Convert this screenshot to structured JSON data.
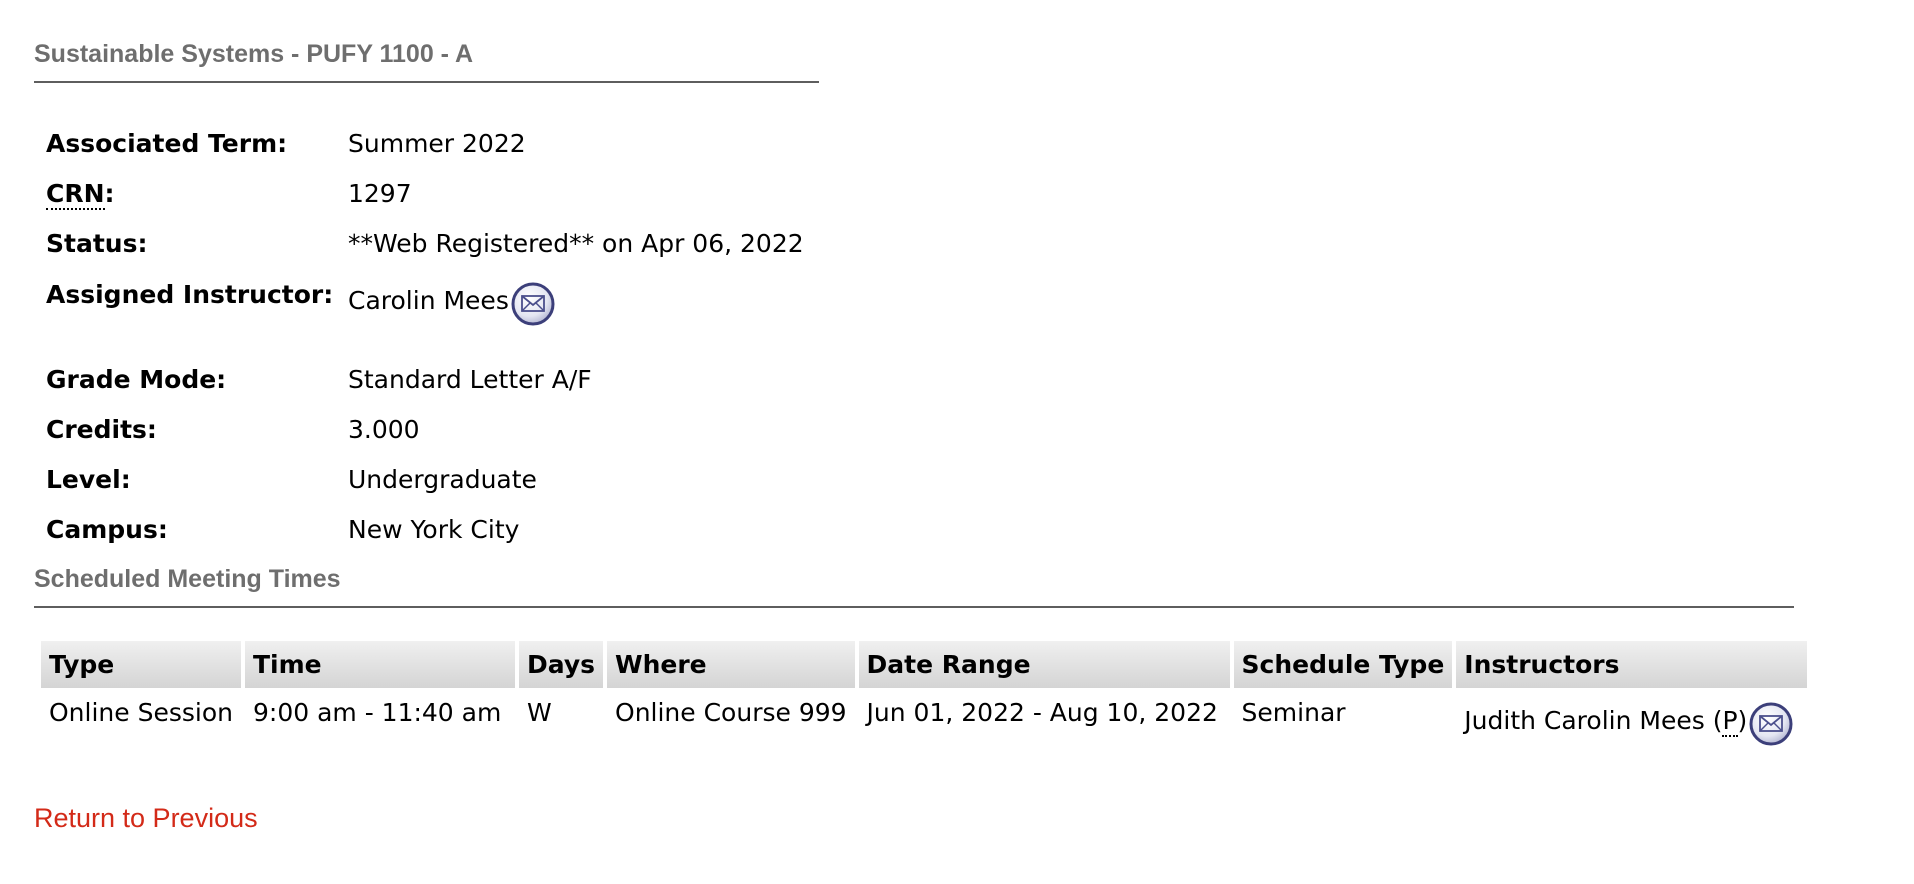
{
  "course": {
    "title": "Sustainable Systems - PUFY 1100 - A"
  },
  "details": {
    "associated_term_label": "Associated Term:",
    "associated_term": "Summer 2022",
    "crn_label": "CRN",
    "crn_colon": ":",
    "crn": "1297",
    "status_label": "Status:",
    "status": "**Web Registered** on Apr 06, 2022",
    "instructor_label": "Assigned Instructor:",
    "instructor": "Carolin Mees",
    "grade_mode_label": "Grade Mode:",
    "grade_mode": "Standard Letter A/F",
    "credits_label": "Credits:",
    "credits": "3.000",
    "level_label": "Level:",
    "level": "Undergraduate",
    "campus_label": "Campus:",
    "campus": "New York City"
  },
  "meetings": {
    "title": "Scheduled Meeting Times",
    "headers": {
      "type": "Type",
      "time": "Time",
      "days": "Days",
      "where": "Where",
      "date_range": "Date Range",
      "schedule_type": "Schedule Type",
      "instructors": "Instructors"
    },
    "rows": [
      {
        "type": "Online Session",
        "time": "9:00 am - 11:40 am",
        "days": "W",
        "where": "Online Course 999",
        "date_range": "Jun 01, 2022 - Aug 10, 2022",
        "schedule_type": "Seminar",
        "instructor": "Judith Carolin Mees",
        "primary_open": " (",
        "primary_marker": "P",
        "primary_close": ")"
      }
    ]
  },
  "links": {
    "return": "Return to Previous"
  },
  "icons": {
    "email": "envelope-email-icon"
  },
  "colors": {
    "section_title": "#6e6e6e",
    "link": "#d32a18",
    "header_bg": "#dddddd"
  }
}
